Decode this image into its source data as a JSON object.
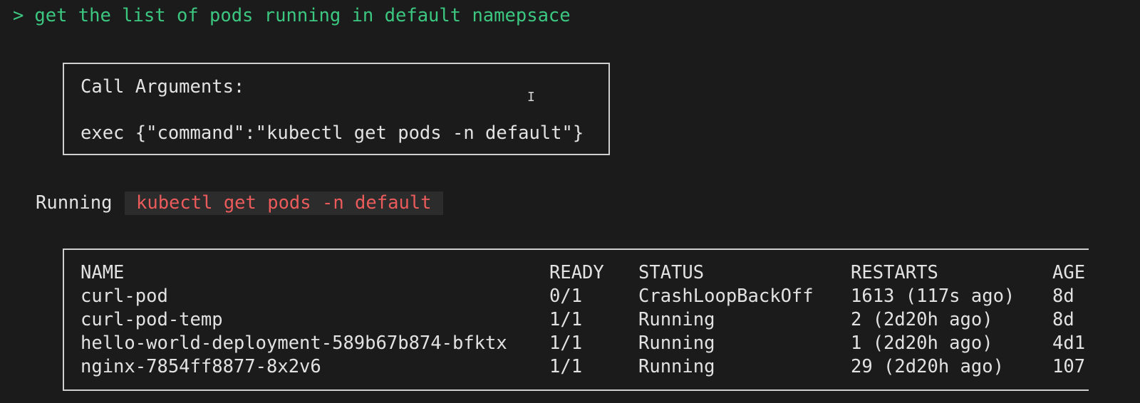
{
  "prompt": {
    "symbol": ">",
    "text": "get the list of pods running in default namepsace"
  },
  "call_arguments": {
    "title": "Call Arguments:",
    "exec_line": "exec {\"command\":\"kubectl get pods -n default\"}"
  },
  "running": {
    "label": "Running",
    "command": "kubectl get pods -n default"
  },
  "pods_table": {
    "headers": {
      "name": "NAME",
      "ready": "READY",
      "status": "STATUS",
      "restarts": "RESTARTS",
      "age": "AGE"
    },
    "rows": [
      {
        "name": "curl-pod",
        "ready": "0/1",
        "status": "CrashLoopBackOff",
        "restarts": "1613 (117s ago)",
        "age": "8d"
      },
      {
        "name": "curl-pod-temp",
        "ready": "1/1",
        "status": "Running",
        "restarts": "2 (2d20h ago)",
        "age": "8d"
      },
      {
        "name": "hello-world-deployment-589b67b874-bfktx",
        "ready": "1/1",
        "status": "Running",
        "restarts": "1 (2d20h ago)",
        "age": "4d1"
      },
      {
        "name": "nginx-7854ff8877-8x2v6",
        "ready": "1/1",
        "status": "Running",
        "restarts": "29 (2d20h ago)",
        "age": "107"
      }
    ]
  },
  "colors": {
    "background": "#1b1b1b",
    "prompt": "#3cc781",
    "command_highlight": "#ec5b5b",
    "text": "#e2e2e2"
  },
  "cursor_icon": "text-cursor-icon"
}
